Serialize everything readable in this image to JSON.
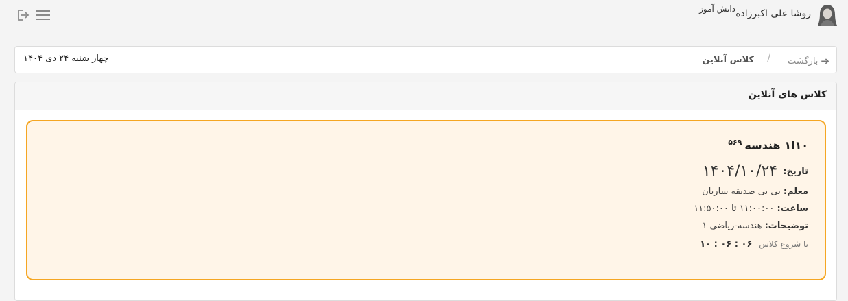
{
  "header": {
    "user_name": "روشا علی اکبرزاده",
    "user_role": "دانش آموز",
    "avatar_icon": "user-avatar-icon",
    "menu_icon": "hamburger-menu-icon",
    "logout_icon": "logout-icon"
  },
  "breadcrumb": {
    "back_label": "بازگشت",
    "back_icon": "arrow-right-icon",
    "separator": "/",
    "current": "کلاس آنلاین",
    "today": "چهار شنبه ۲۴ دی ۱۴۰۴"
  },
  "panel": {
    "title": "کلاس های آنلاین"
  },
  "class_card": {
    "title": "۱۰ا۱ هندسه",
    "code": "۵۶۹",
    "date_label": "تاریخ:",
    "date_value": "۱۴۰۴/۱۰/۲۴",
    "teacher_label": "معلم:",
    "teacher_value": "بی بی صدیقه ساریان",
    "time_label": "ساعت:",
    "time_value": "۱۱:۰۰:۰۰ تا ۱۱:۵۰:۰۰",
    "desc_label": "توضیحات:",
    "desc_value": "هندسه-ریاضی ۱",
    "countdown_label": "تا شروع کلاس",
    "countdown_value": "۰۶ : ۰۶ : ۱۰",
    "border_color": "#f5a623",
    "background_color": "#fff5e8"
  }
}
